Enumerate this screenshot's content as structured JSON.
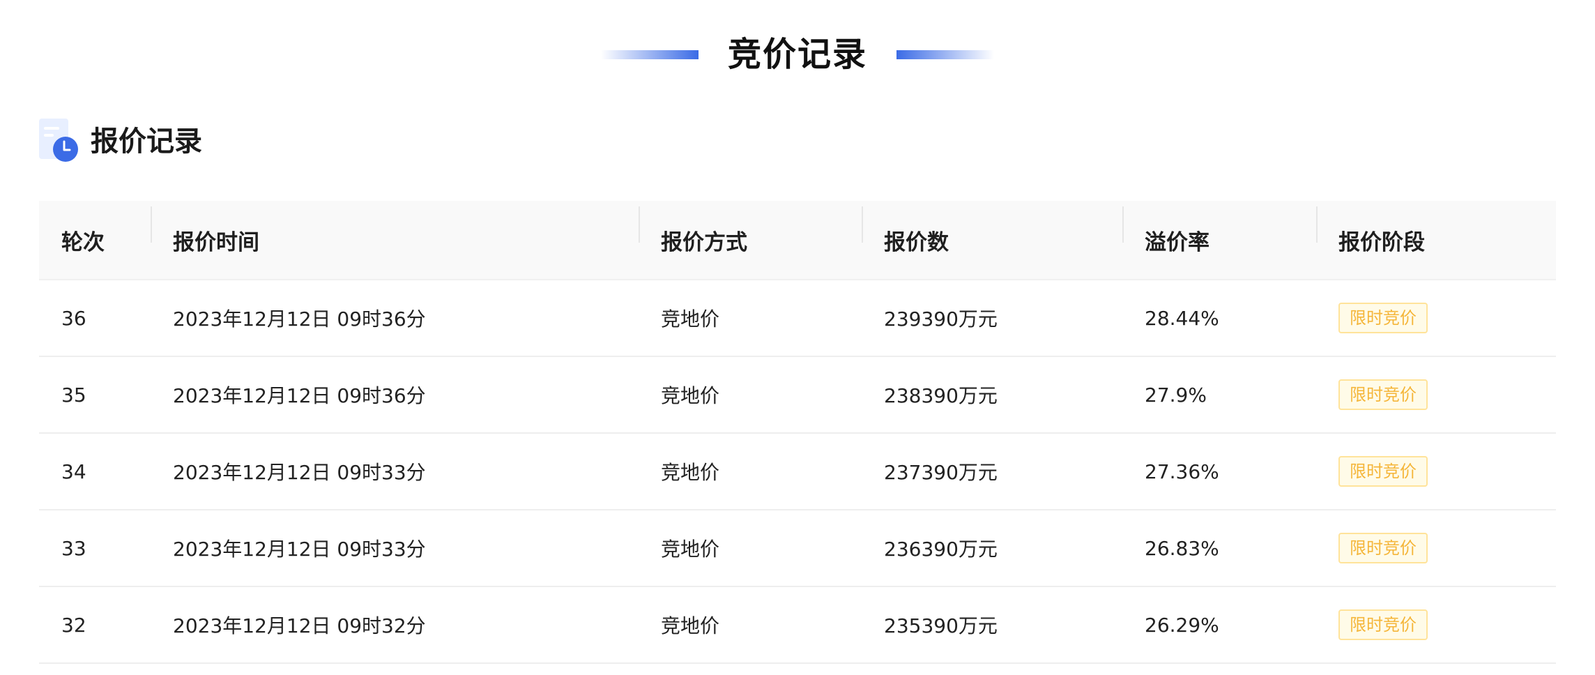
{
  "page": {
    "title": "竞价记录"
  },
  "section": {
    "title": "报价记录",
    "icon": "document-clock-icon",
    "accent_color": "#3b6be6"
  },
  "table": {
    "headers": [
      "轮次",
      "报价时间",
      "报价方式",
      "报价数",
      "溢价率",
      "报价阶段"
    ],
    "rows": [
      {
        "round": "36",
        "time": "2023年12月12日 09时36分",
        "method": "竞地价",
        "amount": "239390万元",
        "premium": "28.44%",
        "stage": "限时竞价"
      },
      {
        "round": "35",
        "time": "2023年12月12日 09时36分",
        "method": "竞地价",
        "amount": "238390万元",
        "premium": "27.9%",
        "stage": "限时竞价"
      },
      {
        "round": "34",
        "time": "2023年12月12日 09时33分",
        "method": "竞地价",
        "amount": "237390万元",
        "premium": "27.36%",
        "stage": "限时竞价"
      },
      {
        "round": "33",
        "time": "2023年12月12日 09时33分",
        "method": "竞地价",
        "amount": "236390万元",
        "premium": "26.83%",
        "stage": "限时竞价"
      },
      {
        "round": "32",
        "time": "2023年12月12日 09时32分",
        "method": "竞地价",
        "amount": "235390万元",
        "premium": "26.29%",
        "stage": "限时竞价"
      }
    ],
    "stage_tag_text_color": "#f5b63a",
    "stage_tag_border_color": "#ffe39a",
    "stage_tag_background": "#fffbe8"
  }
}
